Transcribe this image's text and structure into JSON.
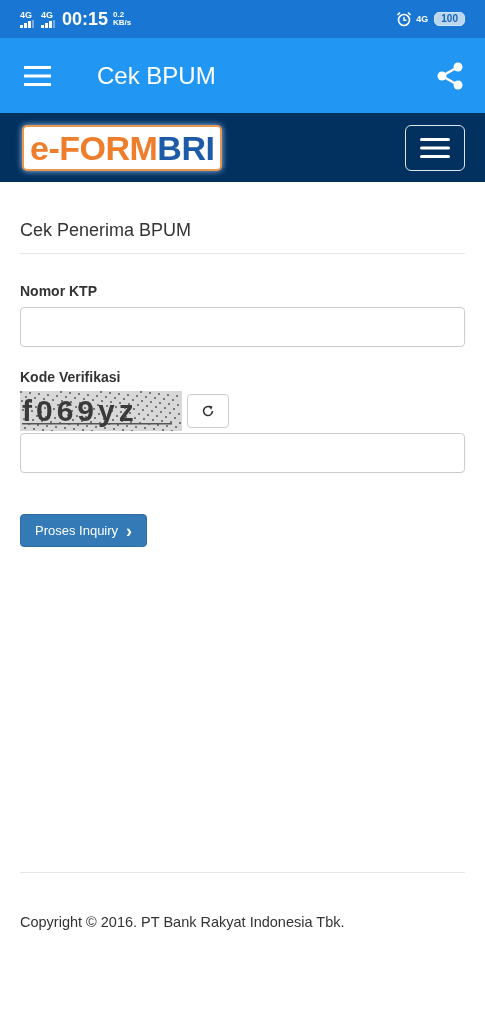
{
  "status_bar": {
    "sim_1": "4G",
    "sim_2": "4G",
    "time": "00:15",
    "speed_value": "0.2",
    "speed_unit": "KB/s",
    "network": "4G",
    "battery": "100"
  },
  "app_bar": {
    "title": "Cek BPUM"
  },
  "brand_bar": {
    "logo_part_1": "e-FORM",
    "logo_part_2": "BRI"
  },
  "form": {
    "heading": "Cek Penerima BPUM",
    "fields": [
      {
        "kind": "text",
        "label": "Nomor KTP"
      },
      {
        "kind": "captcha",
        "label": "Kode Verifikasi",
        "captcha": "f069yz"
      }
    ],
    "submit": {
      "label": "Proses Inquiry",
      "icon": "›"
    }
  },
  "footer": {
    "copyright": "Copyright © 2016. PT Bank Rakyat Indonesia Tbk."
  }
}
